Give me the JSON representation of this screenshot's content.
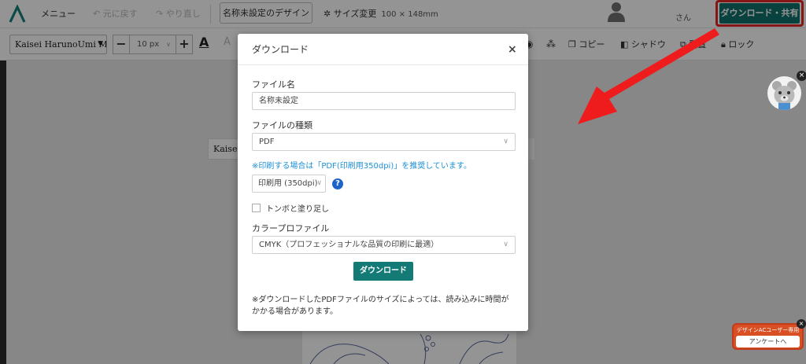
{
  "topbar": {
    "menu_label": "メニュー",
    "undo_label": "元に戻す",
    "redo_label": "やり直し",
    "design_name": "名称未設定のデザイン",
    "size_label": "サイズ変更",
    "size_value": "100 × 148mm",
    "user_suffix": "さん",
    "download_share_label": "ダウンロード・共有"
  },
  "toolbar": {
    "font_name": "Kaisei HarunoUmi M",
    "font_size": "10 px",
    "copy_label": "コピー",
    "shadow_label": "シャドウ",
    "arrange_label": "配置",
    "lock_label": "ロック"
  },
  "canvas": {
    "floating_text": "Kaisei"
  },
  "download_dialog": {
    "title": "ダウンロード",
    "filename_label": "ファイル名",
    "filename_value": "名称未設定",
    "filetype_label": "ファイルの種類",
    "filetype_value": "PDF",
    "print_note": "※印刷する場合は「PDF(印刷用350dpi)」を推奨しています。",
    "quality_value": "印刷用 (350dpi)",
    "trim_marks_label": "トンボと塗り足し",
    "trim_marks_checked": false,
    "color_profile_label": "カラープロファイル",
    "color_profile_value": "CMYK（プロフェッショナルな品質の印刷に最適）",
    "download_button": "ダウンロード",
    "footnote": "※ダウンロードしたPDFファイルのサイズによっては、読み込みに時間がかかる場合があります。"
  },
  "survey_widget": {
    "title": "デザインACユーザー専用",
    "button": "アンケートへ"
  },
  "colors": {
    "brand_teal": "#11706b",
    "highlight_red": "#e52626",
    "link_blue": "#1d8fd6"
  }
}
